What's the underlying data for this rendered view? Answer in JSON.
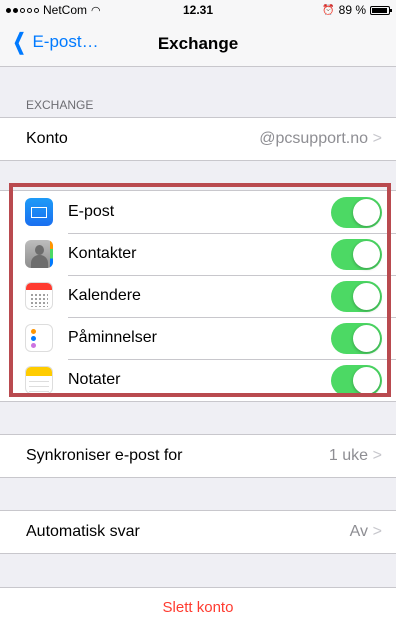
{
  "status": {
    "carrier": "NetCom",
    "time": "12.31",
    "battery_pct": "89 %"
  },
  "nav": {
    "back_label": "E-post…",
    "title": "Exchange"
  },
  "account_section": {
    "header": "EXCHANGE",
    "account_label": "Konto",
    "account_value": "@pcsupport.no"
  },
  "sync_items": [
    {
      "label": "E-post",
      "icon": "mail-icon",
      "on": true
    },
    {
      "label": "Kontakter",
      "icon": "contacts-icon",
      "on": true
    },
    {
      "label": "Kalendere",
      "icon": "calendar-icon",
      "on": true
    },
    {
      "label": "Påminnelser",
      "icon": "reminders-icon",
      "on": true
    },
    {
      "label": "Notater",
      "icon": "notes-icon",
      "on": true
    }
  ],
  "mail_sync": {
    "label": "Synkroniser e-post for",
    "value": "1 uke"
  },
  "auto_reply": {
    "label": "Automatisk svar",
    "value": "Av"
  },
  "delete_account": "Slett konto",
  "colors": {
    "accent": "#007aff",
    "toggle_on": "#4cd964",
    "destructive": "#ff3b30",
    "highlight_border": "#b94a4f"
  }
}
